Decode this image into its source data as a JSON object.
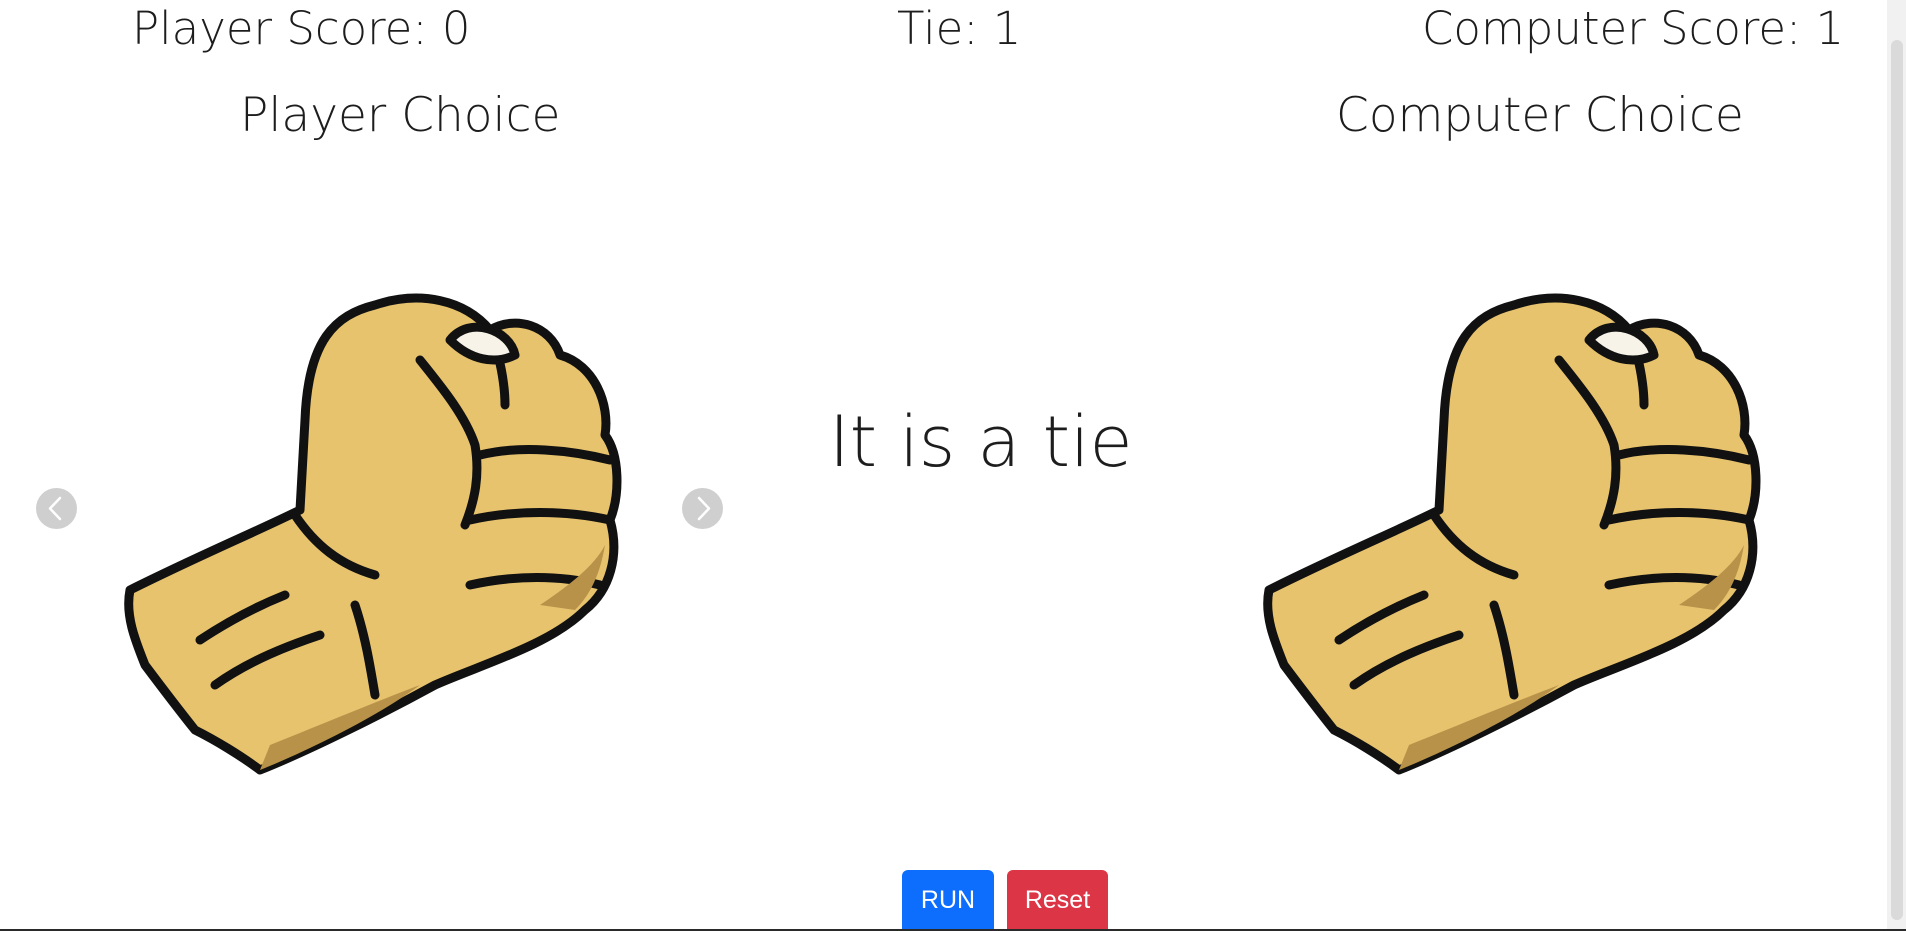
{
  "scoreboard": {
    "player_score": "Player Score: 0",
    "tie": "Tie: 1",
    "computer_score": "Computer Score: 1"
  },
  "player": {
    "heading": "Player Choice",
    "choice_icon": "rock-fist-icon"
  },
  "computer": {
    "heading": "Computer Choice",
    "choice_icon": "rock-fist-icon"
  },
  "result": "It is a tie",
  "carousel": {
    "prev_icon": "chevron-left-icon",
    "next_icon": "chevron-right-icon"
  },
  "buttons": {
    "run": "RUN",
    "reset": "Reset"
  },
  "colors": {
    "run_button": "#0d6efd",
    "reset_button": "#dc3545",
    "skin": "#e8c36e",
    "skin_shadow": "#b9924a"
  }
}
